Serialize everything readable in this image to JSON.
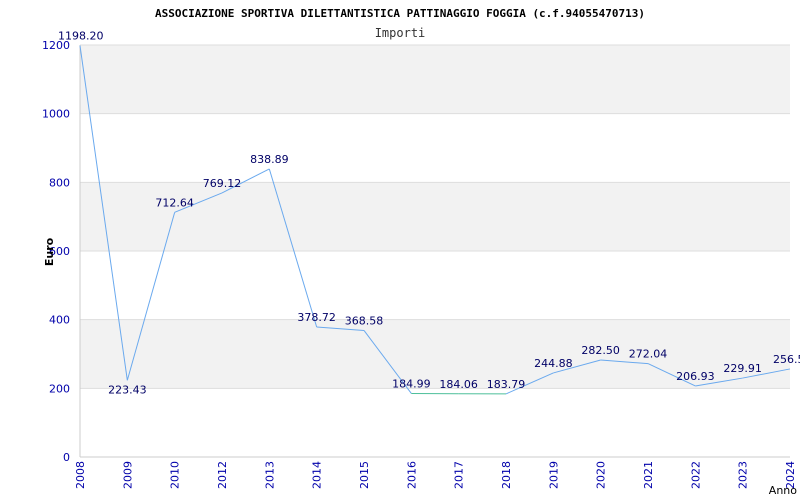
{
  "chart_data": {
    "type": "line",
    "title": "ASSOCIAZIONE SPORTIVA DILETTANTISTICA PATTINAGGIO FOGGIA (c.f.94055470713)",
    "subtitle": "Importi",
    "xlabel": "Anno",
    "ylabel": "Euro",
    "ylim": [
      0,
      1200
    ],
    "yticks": [
      "0",
      "200",
      "400",
      "600",
      "800",
      "1000",
      "1200"
    ],
    "grid": true,
    "categories": [
      "2008",
      "2009",
      "2010",
      "2012",
      "2013",
      "2014",
      "2015",
      "2016",
      "2017",
      "2018",
      "2019",
      "2020",
      "2021",
      "2022",
      "2023",
      "2024"
    ],
    "values": [
      1198.2,
      223.43,
      712.64,
      769.12,
      838.89,
      378.72,
      368.58,
      184.99,
      184.06,
      183.79,
      244.88,
      282.5,
      272.04,
      206.93,
      229.91,
      256.5
    ],
    "value_labels": [
      "1198.20",
      "223.43",
      "712.64",
      "769.12",
      "838.89",
      "378.72",
      "368.58",
      "184.99",
      "184.06",
      "183.79",
      "244.88",
      "282.50",
      "272.04",
      "206.93",
      "229.91",
      "256.5"
    ],
    "colors": {
      "line": "#6aa9ee",
      "flat_segment": "#4dbf9a",
      "band": "#f2f2f2",
      "grid": "#dddddd",
      "axis": "#cccccc",
      "ticks": "#0000aa",
      "labels": "#000066"
    }
  }
}
